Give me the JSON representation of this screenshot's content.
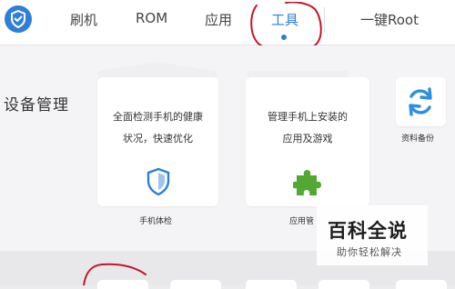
{
  "nav": {
    "tabs": [
      {
        "label": "刷机",
        "active": false
      },
      {
        "label": "ROM",
        "active": false
      },
      {
        "label": "应用",
        "active": false
      },
      {
        "label": "工具",
        "active": true
      },
      {
        "label": "一键Root",
        "active": false
      }
    ]
  },
  "section": {
    "title": "设备管理"
  },
  "cards": [
    {
      "description_lines": [
        "全面检测手机的健康",
        "状况，快速优化"
      ],
      "label": "手机体检",
      "icon": "shield-icon"
    },
    {
      "description_lines": [
        "管理手机上安装的",
        "应用及游戏"
      ],
      "label": "应用管",
      "icon": "puzzle-icon"
    },
    {
      "description_lines": [],
      "label": "资料备份",
      "icon": "sync-icon"
    }
  ],
  "watermark": {
    "title": "百科全说",
    "subtitle": "助你轻松解决"
  },
  "colors": {
    "accent": "#2d7fd8",
    "annotation": "#c0162a",
    "puzzle": "#52a832",
    "page_bg": "#f4f4f6"
  }
}
